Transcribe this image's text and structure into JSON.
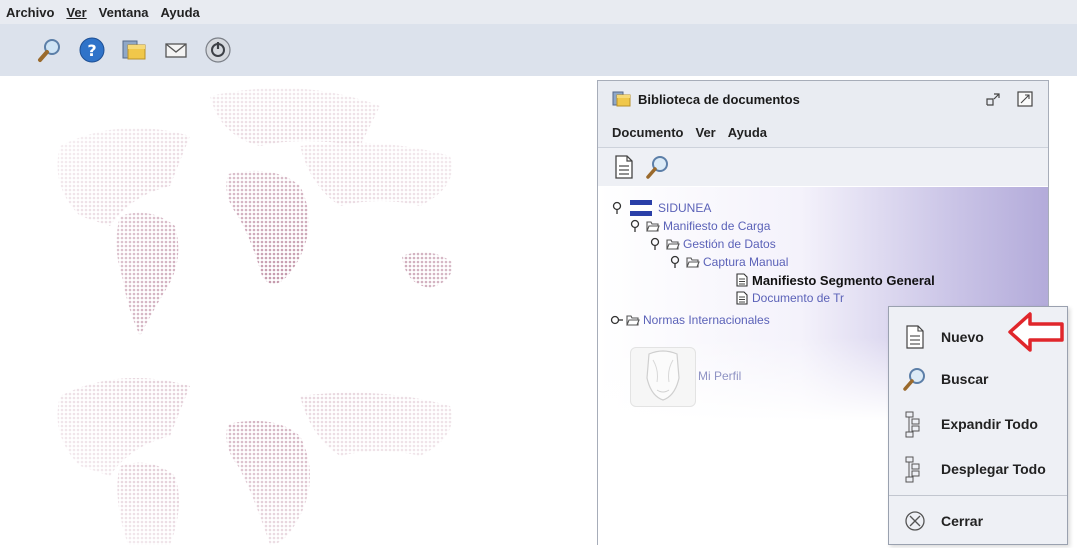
{
  "menubar": {
    "items": [
      {
        "label": "Archivo"
      },
      {
        "label": "Ver"
      },
      {
        "label": "Ventana"
      },
      {
        "label": "Ayuda"
      }
    ]
  },
  "toolbar": {
    "icons": [
      "search-icon",
      "help-icon",
      "document-library-icon",
      "mail-icon",
      "power-icon"
    ]
  },
  "window": {
    "title": "Biblioteca de documentos",
    "menu": [
      {
        "label": "Documento"
      },
      {
        "label": "Ver"
      },
      {
        "label": "Ayuda"
      }
    ],
    "tools": [
      "new-document-icon",
      "search-icon"
    ],
    "tree": {
      "root": "SIDUNEA",
      "n1": "Manifiesto de Carga",
      "n2": "Gestión de Datos",
      "n3": "Captura Manual",
      "leaf1": "Manifiesto Segmento General",
      "leaf2": "Documento de Tr",
      "other": "Normas Internacionales"
    },
    "profile_label": "Mi Perfil"
  },
  "context_menu": {
    "items": [
      {
        "label": "Nuevo",
        "icon": "new-document-icon"
      },
      {
        "label": "Buscar",
        "icon": "search-icon"
      },
      {
        "label": "Expandir Todo",
        "icon": "expand-all-icon"
      },
      {
        "label": "Desplegar Todo",
        "icon": "collapse-all-icon"
      },
      {
        "label": "Cerrar",
        "icon": "close-circle-icon"
      }
    ]
  },
  "colors": {
    "arrow": "#e0262b",
    "flag_blue": "#2a3fa8",
    "tree_link": "#5b62b8"
  }
}
